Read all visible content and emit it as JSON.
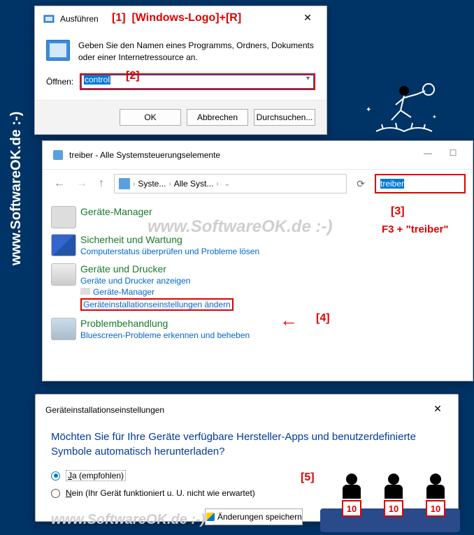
{
  "vertical_watermark": "www.SoftwareOK.de :-)",
  "run": {
    "title": "Ausführen",
    "desc": "Geben Sie den Namen eines Programms, Ordners, Dokuments oder einer Internetressource an.",
    "open_label": "Öffnen:",
    "open_value": "control",
    "ok": "OK",
    "cancel": "Abbrechen",
    "browse": "Durchsuchen..."
  },
  "annotations": {
    "a1": "[1]",
    "a1_sub": "[Windows-Logo]+[R]",
    "a2": "[2]",
    "a3": "[3]",
    "a3_sub": "F3 + \"treiber\"",
    "a4": "[4]",
    "a5": "[5]"
  },
  "cpl": {
    "title": "treiber - Alle Systemsteuerungselemente",
    "addr_seg1": "Syste...",
    "addr_seg2": "Alle Syst...",
    "search_value": "treiber",
    "items": [
      {
        "head": "Geräte-Manager",
        "subs": []
      },
      {
        "head": "Sicherheit und Wartung",
        "subs": [
          "Computerstatus überprüfen und Probleme lösen"
        ]
      },
      {
        "head": "Geräte und Drucker",
        "subs": [
          "Geräte und Drucker anzeigen",
          "Geräte-Manager",
          "Geräteinstallationseinstellungen ändern"
        ]
      },
      {
        "head": "Problembehandlung",
        "subs": [
          "Bluescreen-Probleme erkennen und beheben"
        ]
      }
    ],
    "watermark": "www.SoftwareOK.de :-)"
  },
  "settings": {
    "title": "Geräteinstallationseinstellungen",
    "question": "Möchten Sie für Ihre Geräte verfügbare Hersteller-Apps und benutzerdefinierte Symbole automatisch herunterladen?",
    "opt_yes_pre": "J",
    "opt_yes_rest": "a (empfohlen)",
    "opt_no_pre": "N",
    "opt_no_rest": "ein (Ihr Gerät funktioniert u. U. nicht wie erwartet)",
    "save": "Änderungen speichern",
    "watermark": "www.SoftwareOK.de :-)"
  },
  "judges_score": "10"
}
